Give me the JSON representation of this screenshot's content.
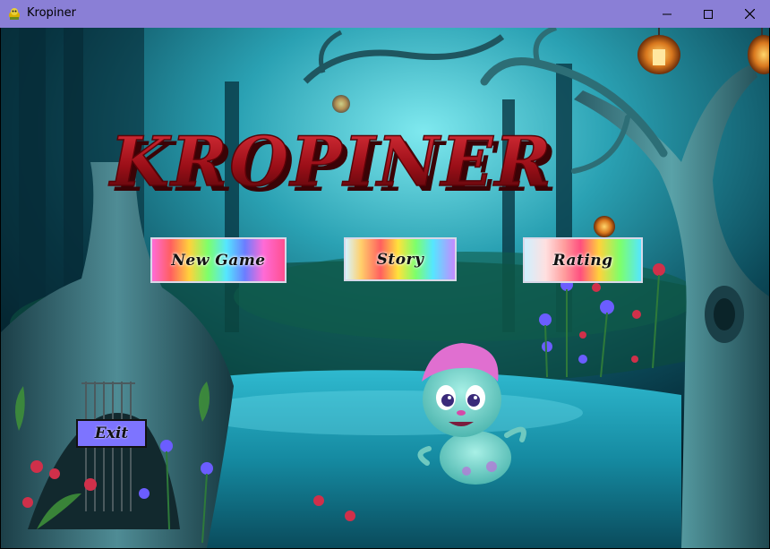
{
  "window": {
    "title": "Kropiner",
    "minimize_glyph": "—",
    "maximize_glyph": "☐",
    "close_glyph": "✕"
  },
  "game": {
    "logo_text": "KROPINER",
    "menu": {
      "new_game": "New Game",
      "story": "Story",
      "rating": "Rating",
      "exit": "Exit"
    }
  },
  "colors": {
    "titlebar": "#8a7fd6",
    "logo_red": "#b3121c",
    "exit_button": "#7d74ff",
    "water": "#1e9fb6"
  },
  "icons": [
    "app-icon",
    "lantern-icon",
    "mascot-creature",
    "flower-decor"
  ]
}
